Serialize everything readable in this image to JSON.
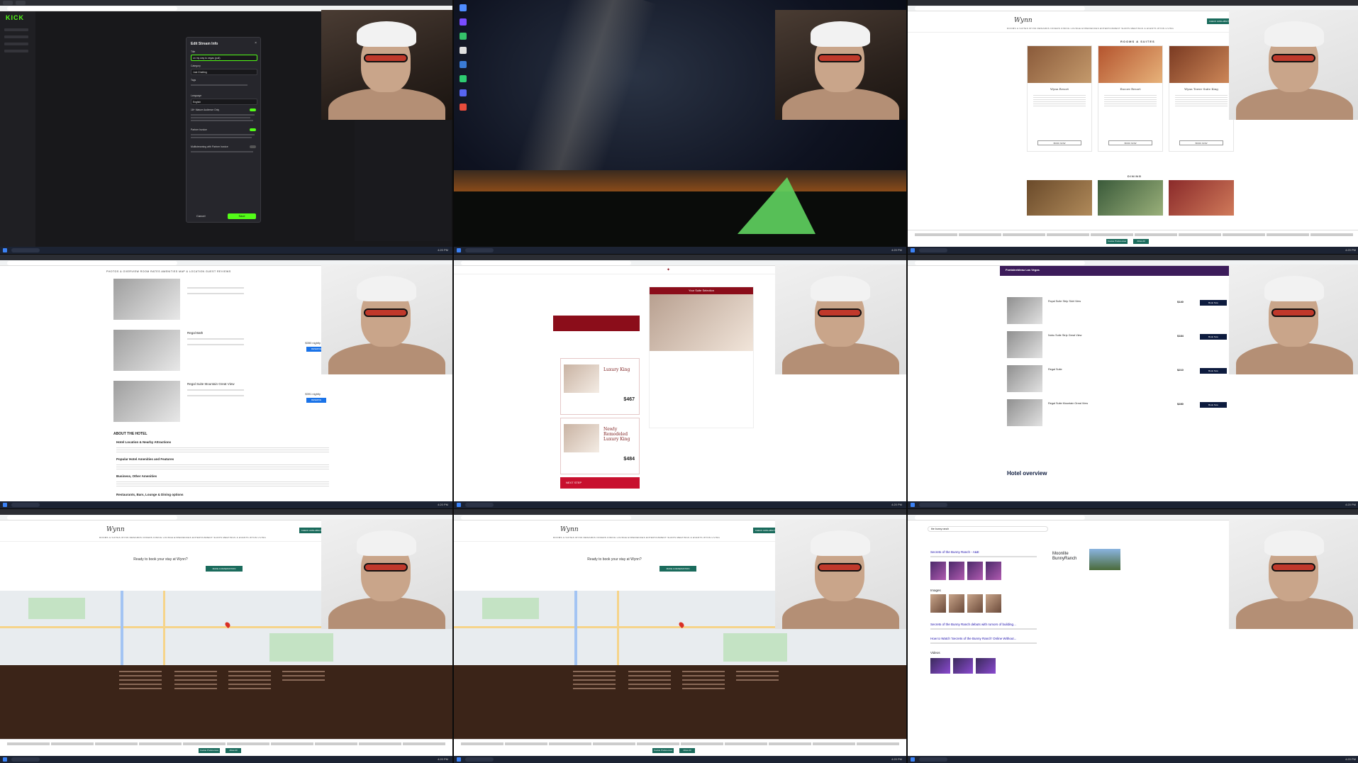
{
  "tiles": {
    "t1": {
      "brand": "KICK",
      "modal_title": "Edit Stream Info",
      "close_glyph": "×",
      "title_label": "Title",
      "title_value": "on my way to vegas (pull)",
      "category_label": "Category",
      "category_value": "Just Chatting",
      "tags_label": "Tags",
      "language_label": "Language",
      "language_value": "English",
      "mature_label": "18+ Mature Audience Only",
      "partner_label": "Partner Invoice",
      "multistream_label": "Multistreaming with Partner Invoice",
      "cancel_label": "Cancel",
      "save_label": "Save"
    },
    "t3": {
      "logo": "Wynn",
      "nav": "ROOMS & SUITES   WYNN REWARDS   OFFERS   DINING   LOUNGE   EXPERIENCES   ENTERTAINMENT   SHOPS   MEETINGS & EVENTS   WYNN LIVING",
      "check_label": "CHECK AVAILABILITY",
      "section_rooms": "ROOMS & SUITES",
      "section_dining": "DINING",
      "cards": [
        {
          "title": "Wynn Resort",
          "book": "BOOK NOW"
        },
        {
          "title": "Encore Resort",
          "book": "BOOK NOW"
        },
        {
          "title": "Wynn Tower Suite King",
          "book": "BOOK NOW"
        }
      ],
      "cookie_btn1": "Cookie Preferences",
      "cookie_btn2": "Allow All"
    },
    "t4": {
      "tabs": "PHOTOS & OVERVIEW     ROOM RATES     AMENITIES     MAP & LOCATION     GUEST REVIEWS",
      "rooms": [
        {
          "name": "",
          "price": ""
        },
        {
          "name": "Regal Bath",
          "price": "$350 nightly",
          "btn": "RESERVE"
        },
        {
          "name": "Regal Suite Mountain Great View",
          "price": "$391 nightly",
          "btn": "RESERVE"
        }
      ],
      "about": "ABOUT THE HOTEL",
      "sub1": "Hotel Location & Nearby Attractions",
      "sub2": "Popular Hotel Amenities and Features",
      "sub3": "Business, Other Amenities",
      "sub4": "Restaurants, Bars, Lounge & Dining options"
    },
    "t5": {
      "rooms": [
        {
          "name": "Luxury King",
          "price": "$467"
        },
        {
          "name": "Newly Remodeled Luxury King",
          "price": "$484"
        }
      ],
      "suite_title": "Your Suite Selection",
      "next_label": "NEXT STEP"
    },
    "t6": {
      "header": "Fontainebleau Las Vegas",
      "rows": [
        {
          "name": "Royal Suite Strip Skirt View",
          "price": "$140",
          "btn": "Book Now"
        },
        {
          "name": "Nobu Suite Strip Great View",
          "price": "$184",
          "btn": "Book Now"
        },
        {
          "name": "Regal Suite",
          "price": "$210",
          "btn": "Book Now"
        },
        {
          "name": "Regal Suite Mountain Great View",
          "price": "$280",
          "btn": "Book Now"
        }
      ],
      "overview": "Hotel overview"
    },
    "t7": {
      "ready": "Ready to book your stay at Wynn?",
      "reserve": "MAKE A RESERVATION"
    },
    "t8": {
      "ready": "Ready to book your stay at Wynn?",
      "reserve": "MAKE A RESERVATION"
    },
    "t9": {
      "query": "the bunny ranch",
      "kp_title": "Moonlite BunnyRanch",
      "results": [
        "Secrets of the Bunny Ranch - A&E",
        "Secrets of the Bunny Ranch debuts with rumors of building...",
        "How to Watch 'Secrets of the Bunny Ranch' Online Without..."
      ],
      "images_label": "Images",
      "videos_label": "Videos"
    }
  },
  "taskbar": {
    "clock": "4:20 PM"
  }
}
